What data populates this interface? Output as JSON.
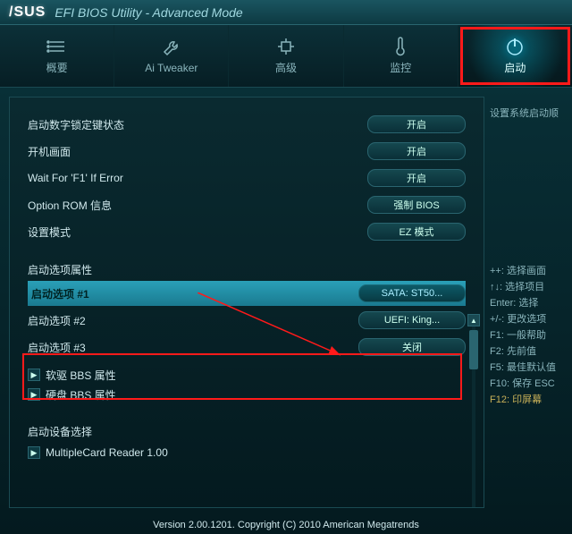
{
  "titlebar": {
    "logo": "/SUS",
    "title": "EFI BIOS Utility - Advanced Mode"
  },
  "tabs": [
    {
      "label": "概要"
    },
    {
      "label": "Ai Tweaker"
    },
    {
      "label": "高级"
    },
    {
      "label": "监控"
    },
    {
      "label": "启动",
      "active": true
    }
  ],
  "settings": [
    {
      "label": "启动数字锁定键状态",
      "value": "开启"
    },
    {
      "label": "开机画面",
      "value": "开启"
    },
    {
      "label": "Wait For 'F1' If Error",
      "value": "开启"
    },
    {
      "label": "Option ROM 信息",
      "value": "强制 BIOS"
    },
    {
      "label": "设置模式",
      "value": "EZ 模式"
    }
  ],
  "boot_section_title": "启动选项属性",
  "boot_options": [
    {
      "label": "启动选项 #1",
      "value": "SATA: ST50...",
      "selected": true
    },
    {
      "label": "启动选项 #2",
      "value": "UEFI: King..."
    },
    {
      "label": "启动选项 #3",
      "value": "关闭"
    }
  ],
  "bbs": [
    {
      "label": "软驱 BBS 属性"
    },
    {
      "label": "硬盘 BBS 属性"
    }
  ],
  "device_section_title": "启动设备选择",
  "devices": [
    {
      "label": "MultipleCard Reader 1.00"
    }
  ],
  "side": {
    "desc": "设置系统启动顺",
    "help": [
      "++: 选择画面",
      "↑↓: 选择项目",
      "Enter: 选择",
      "+/-: 更改选项",
      "F1: 一般帮助",
      "F2: 先前值",
      "F5: 最佳默认值",
      "F10: 保存  ESC"
    ],
    "f12": "F12: 印屏幕"
  },
  "footer": "Version 2.00.1201. Copyright (C) 2010 American Megatrends"
}
